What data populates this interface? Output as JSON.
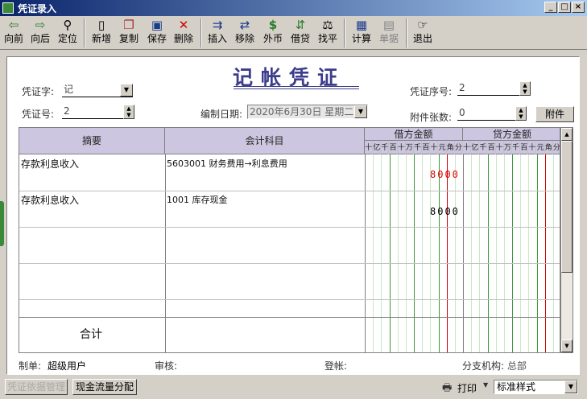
{
  "window": {
    "title": "凭证录入",
    "min": "_",
    "max": "□",
    "close": "×"
  },
  "toolbar": {
    "items": [
      {
        "label": "向前",
        "icon": "⇦"
      },
      {
        "label": "向后",
        "icon": "⇨"
      },
      {
        "label": "定位",
        "icon": "⚲"
      },
      {
        "label": "新增",
        "icon": "▯"
      },
      {
        "label": "复制",
        "icon": "❐"
      },
      {
        "label": "保存",
        "icon": "▣"
      },
      {
        "label": "删除",
        "icon": "✕"
      },
      {
        "label": "插入",
        "icon": "⇉"
      },
      {
        "label": "移除",
        "icon": "⇄"
      },
      {
        "label": "外币",
        "icon": "$"
      },
      {
        "label": "借贷",
        "icon": "⇵"
      },
      {
        "label": "找平",
        "icon": "⚖"
      },
      {
        "label": "计算",
        "icon": "▦"
      },
      {
        "label": "单据",
        "icon": "▤"
      },
      {
        "label": "退出",
        "icon": "☞"
      }
    ]
  },
  "voucher": {
    "title": "记帐凭证",
    "type_label": "凭证字:",
    "type_value": "记",
    "number_label": "凭证号:",
    "number_value": "2",
    "date_label": "编制日期:",
    "date_value": "2020年6月30日  星期二",
    "seq_label": "凭证序号:",
    "seq_value": "2",
    "attach_label": "附件张数:",
    "attach_value": "0",
    "attach_button": "附件"
  },
  "grid": {
    "headers": {
      "summary": "摘要",
      "account": "会计科目",
      "debit": "借方金额",
      "credit": "贷方金额"
    },
    "digits": [
      "十",
      "亿",
      "千",
      "百",
      "十",
      "万",
      "千",
      "百",
      "十",
      "元",
      "角",
      "分"
    ],
    "rows": [
      {
        "summary": "存款利息收入",
        "account": "5603001 财务费用→利息费用",
        "debit": "8000",
        "credit": ""
      },
      {
        "summary": "存款利息收入",
        "account": "1001 库存现金",
        "debit": "",
        "credit": "8000"
      },
      {
        "summary": "",
        "account": "",
        "debit": "",
        "credit": ""
      },
      {
        "summary": "",
        "account": "",
        "debit": "",
        "credit": ""
      }
    ],
    "total_label": "合计"
  },
  "footer": {
    "maker_label": "制单:",
    "maker_value": "超级用户",
    "auditor_label": "审核:",
    "poster_label": "登帐:",
    "branch_label": "分支机构:",
    "branch_value": "总部"
  },
  "statusbar": {
    "reference_button": "凭证依据管理",
    "cashflow_button": "现金流量分配",
    "print_label": "打印",
    "style_value": "标准样式"
  },
  "colors": {
    "debit_amount": "#e00000",
    "credit_amount": "#000000",
    "title": "#3c3c8c",
    "header_bg": "#cdc6e0"
  }
}
